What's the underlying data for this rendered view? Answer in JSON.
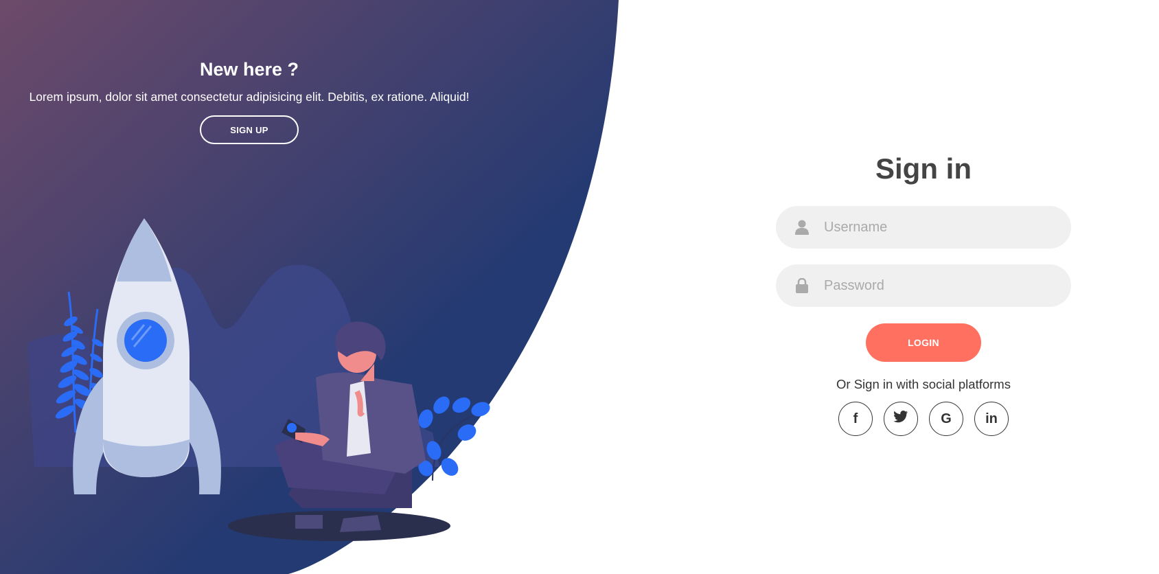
{
  "colors": {
    "gradient_start": "#6d4a6a",
    "gradient_end": "#243a72",
    "accent_coral": "#ff7061",
    "accent_blue": "#2a6cf6",
    "input_bg": "#f0f0f0"
  },
  "left_panel": {
    "title": "New here ?",
    "description": "Lorem ipsum, dolor sit amet consectetur adipisicing elit. Debitis, ex ratione. Aliquid!",
    "signup_label": "SIGN UP"
  },
  "sign_in": {
    "title": "Sign in",
    "username_placeholder": "Username",
    "username_icon": "user-icon",
    "password_placeholder": "Password",
    "password_icon": "lock-icon",
    "login_label": "LOGIN",
    "social_text": "Or Sign in with social platforms",
    "social": [
      {
        "name": "facebook-icon",
        "glyph": "f"
      },
      {
        "name": "twitter-icon",
        "glyph": ""
      },
      {
        "name": "google-icon",
        "glyph": "G"
      },
      {
        "name": "linkedin-icon",
        "glyph": "in"
      }
    ]
  }
}
